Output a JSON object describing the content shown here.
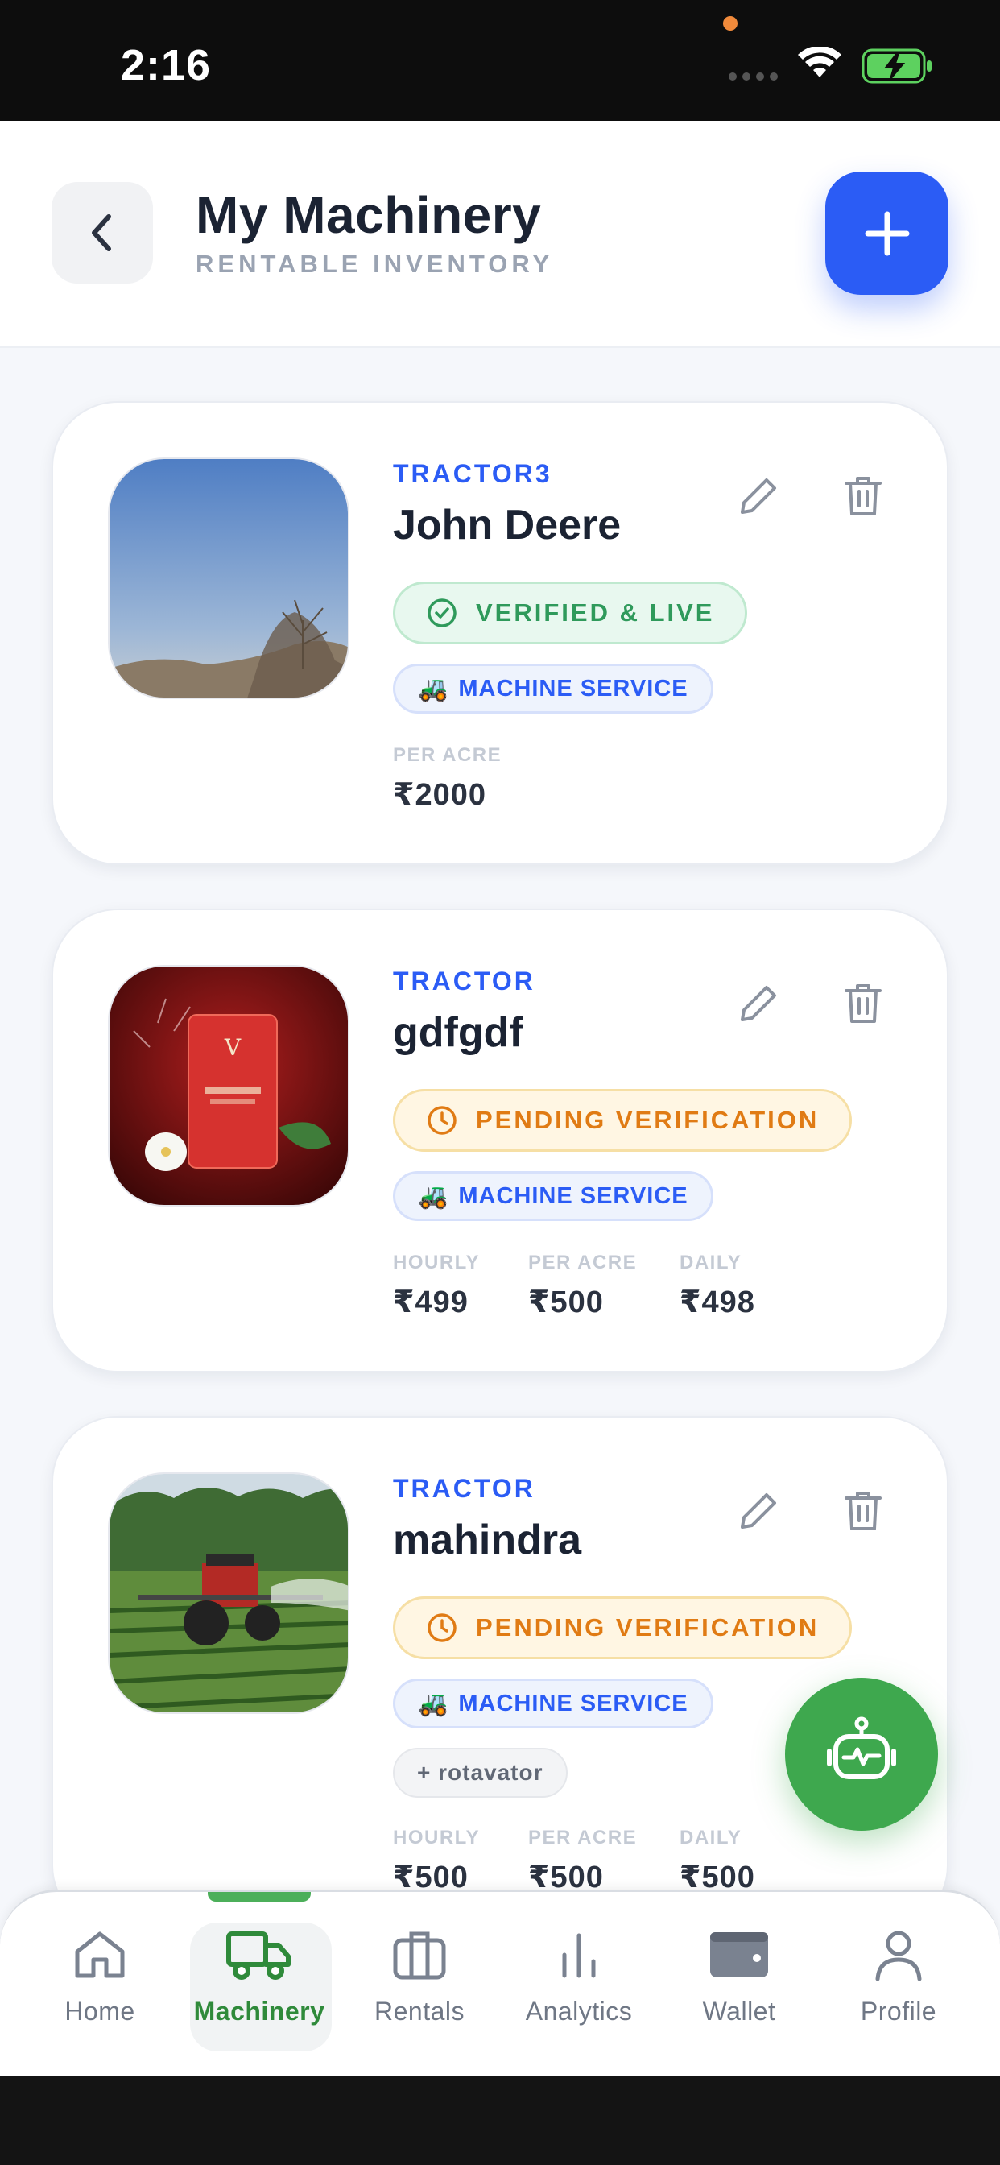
{
  "status_bar": {
    "time": "2:16"
  },
  "header": {
    "title": "My Machinery",
    "subtitle": "RENTABLE INVENTORY"
  },
  "machines": [
    {
      "category": "TRACTOR3",
      "name": "John Deere",
      "status": "VERIFIED & LIVE",
      "status_type": "verified",
      "service": "MACHINE SERVICE",
      "prices": [
        {
          "label": "PER ACRE",
          "value": "₹2000"
        }
      ]
    },
    {
      "category": "TRACTOR",
      "name": "gdfgdf",
      "status": "PENDING VERIFICATION",
      "status_type": "pending",
      "service": "MACHINE SERVICE",
      "prices": [
        {
          "label": "HOURLY",
          "value": "₹499"
        },
        {
          "label": "PER ACRE",
          "value": "₹500"
        },
        {
          "label": "DAILY",
          "value": "₹498"
        }
      ]
    },
    {
      "category": "TRACTOR",
      "name": "mahindra",
      "status": "PENDING VERIFICATION",
      "status_type": "pending",
      "service": "MACHINE SERVICE",
      "extra": "+ rotavator",
      "prices": [
        {
          "label": "HOURLY",
          "value": "₹500"
        },
        {
          "label": "PER ACRE",
          "value": "₹500"
        },
        {
          "label": "DAILY",
          "value": "₹500"
        }
      ]
    }
  ],
  "nav": {
    "items": [
      {
        "label": "Home",
        "icon": "home-icon"
      },
      {
        "label": "Machinery",
        "icon": "truck-icon",
        "active": true
      },
      {
        "label": "Rentals",
        "icon": "briefcase-icon"
      },
      {
        "label": "Analytics",
        "icon": "bar-chart-icon"
      },
      {
        "label": "Wallet",
        "icon": "wallet-icon"
      },
      {
        "label": "Profile",
        "icon": "user-icon"
      }
    ]
  },
  "colors": {
    "primary_blue": "#2b5cf5",
    "brand_green": "#3ea84e",
    "verified_green": "#2f9a5b",
    "pending_orange": "#e07b14"
  }
}
